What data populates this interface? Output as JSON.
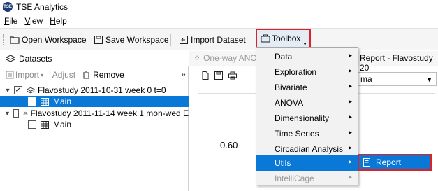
{
  "app": {
    "title": "TSE Analytics",
    "logo_text": "TSE"
  },
  "menubar": {
    "items": [
      {
        "letter": "F",
        "rest": "ile"
      },
      {
        "letter": "V",
        "rest": "iew"
      },
      {
        "letter": "H",
        "rest": "elp"
      }
    ]
  },
  "toolbar": {
    "open_workspace": "Open Workspace",
    "save_workspace": "Save Workspace",
    "import_dataset": "Import Dataset",
    "toolbox": "Toolbox"
  },
  "datasets": {
    "tab_label": "Datasets",
    "import_label": "Import",
    "adjust_label": "Adjust",
    "remove_label": "Remove",
    "collapse_glyph": "»",
    "items": [
      {
        "label": "Flavostudy 2011-10-31 week 0 t=0",
        "checked": true,
        "child": "Main"
      },
      {
        "label": "Flavostudy 2011-11-14 week 1 mon-wed E",
        "checked": false,
        "child": "Main"
      }
    ]
  },
  "tabs": {
    "tab1": "One-way ANO",
    "tab2": "Report - Flavostudy 20"
  },
  "combo": {
    "value": "ma"
  },
  "plot": {
    "y_tick": "0.60"
  },
  "toolbox_menu": {
    "items": [
      {
        "label": "Data",
        "submenu": true,
        "state": "normal"
      },
      {
        "label": "Exploration",
        "submenu": true,
        "state": "normal"
      },
      {
        "label": "Bivariate",
        "submenu": true,
        "state": "normal"
      },
      {
        "label": "ANOVA",
        "submenu": true,
        "state": "normal"
      },
      {
        "label": "Dimensionality",
        "submenu": true,
        "state": "normal"
      },
      {
        "label": "Time Series",
        "submenu": true,
        "state": "normal"
      },
      {
        "label": "Circadian Analysis",
        "submenu": true,
        "state": "normal"
      },
      {
        "label": "Utils",
        "submenu": true,
        "state": "active"
      },
      {
        "label": "IntelliCage",
        "submenu": true,
        "state": "disabled"
      }
    ],
    "submenu": {
      "label": "Report"
    }
  },
  "colors": {
    "accent": "#0a78d7",
    "highlight_border": "#d9222a"
  }
}
